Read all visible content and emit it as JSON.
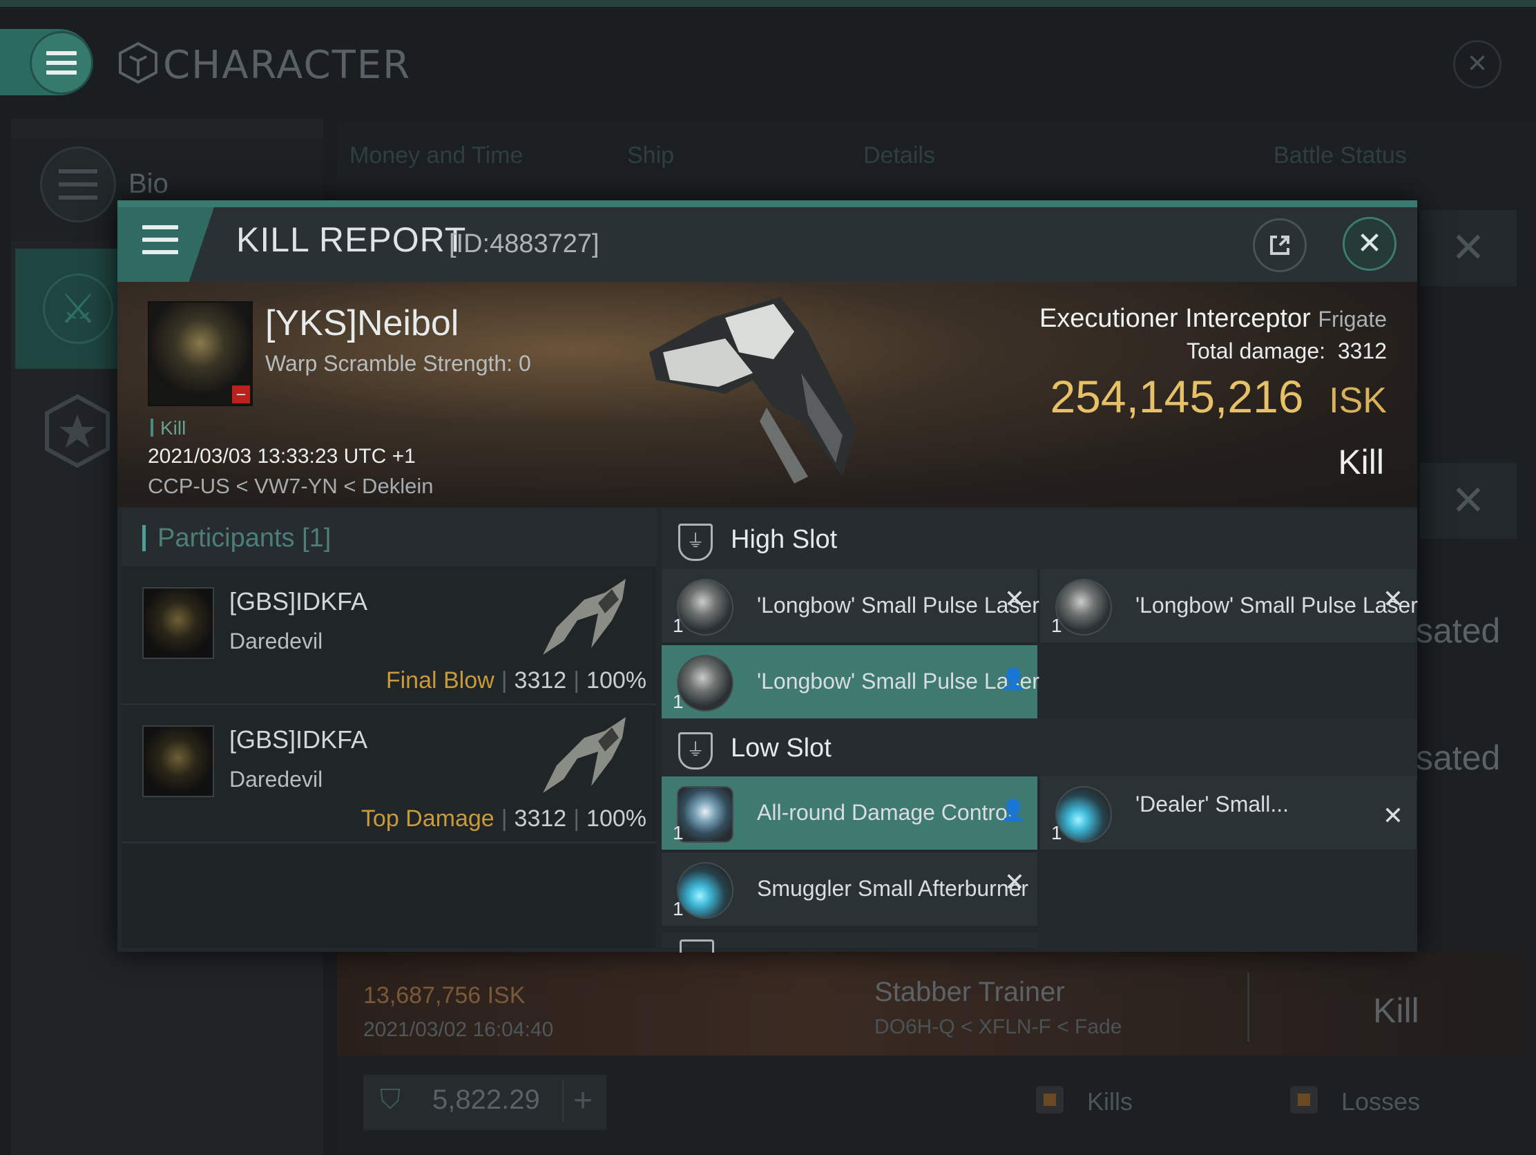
{
  "app": {
    "title": "CHARACTER"
  },
  "sidebar": {
    "items": [
      {
        "label": "Bio"
      }
    ]
  },
  "background": {
    "tabs": [
      "Money and Time",
      "Ship",
      "Details",
      "Battle Status"
    ],
    "sated_text": [
      "sated",
      "sated"
    ],
    "kill_row": {
      "isk": "13,687,756  ISK",
      "date": "2021/03/02  16:04:40",
      "ship": "Stabber Trainer",
      "location": "DO6H-Q < XFLN-F < Fade",
      "result": "Kill"
    },
    "balance": "5,822.29",
    "filters": {
      "kills": "Kills",
      "losses": "Losses",
      "kills_color": "#6a4a22",
      "losses_color": "#6a4a22"
    }
  },
  "modal": {
    "title": "KILL REPORT",
    "id": "[ID:4883727]",
    "victim": {
      "name": "[YKS]Neibol",
      "subtitle": "Warp Scramble Strength: 0",
      "tag": "Kill",
      "datetime": "2021/03/03 13:33:23 UTC +1",
      "location": "CCP-US < VW7-YN < Deklein"
    },
    "ship": {
      "name": "Executioner Interceptor",
      "class": "Frigate",
      "total_damage_label": "Total damage:",
      "total_damage": "3312",
      "isk_value": "254,145,216",
      "isk_unit": "ISK",
      "result": "Kill"
    },
    "participants": {
      "title": "Participants",
      "count": "[1]",
      "rows": [
        {
          "name": "[GBS]IDKFA",
          "ship": "Daredevil",
          "role": "Final Blow",
          "damage": "3312",
          "percent": "100%"
        },
        {
          "name": "[GBS]IDKFA",
          "ship": "Daredevil",
          "role": "Top Damage",
          "damage": "3312",
          "percent": "100%"
        }
      ]
    },
    "slots": {
      "high": {
        "label": "High Slot",
        "items": [
          {
            "name": "'Longbow' Small Pulse Laser",
            "qty": "1"
          },
          {
            "name": "'Longbow' Small Pulse Laser",
            "qty": "1"
          },
          {
            "name": "'Longbow' Small Pulse Laser",
            "qty": "1"
          }
        ]
      },
      "low": {
        "label": "Low Slot",
        "items": [
          {
            "name": "All-round Damage Control",
            "qty": "1"
          },
          {
            "name": "'Dealer' Small...",
            "qty": "1"
          },
          {
            "name": "Smuggler Small Afterburner",
            "qty": "1"
          }
        ]
      }
    }
  },
  "colors": {
    "accent": "#3e7a70",
    "isk": "#e7c167",
    "role_label": "#c99a3c"
  }
}
